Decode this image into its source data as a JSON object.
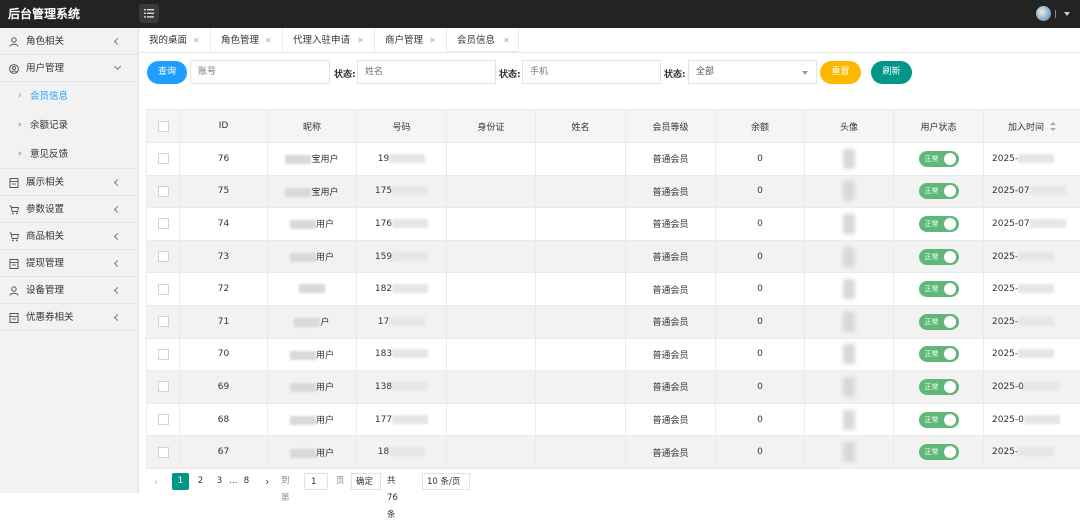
{
  "app": {
    "title": "后台管理系统"
  },
  "sidebar": {
    "items": [
      {
        "label": "角色相关",
        "icon": "user-icon"
      },
      {
        "label": "用户管理",
        "icon": "user-circle-icon",
        "expanded": true,
        "children": [
          {
            "label": "会员信息",
            "active": true
          },
          {
            "label": "余额记录"
          },
          {
            "label": "意见反馈"
          }
        ]
      },
      {
        "label": "展示相关",
        "icon": "document-icon"
      },
      {
        "label": "参数设置",
        "icon": "cart-icon"
      },
      {
        "label": "商品相关",
        "icon": "cart-icon"
      },
      {
        "label": "提现管理",
        "icon": "document-icon"
      },
      {
        "label": "设备管理",
        "icon": "user-icon"
      },
      {
        "label": "优惠券相关",
        "icon": "document-icon"
      }
    ]
  },
  "tabs": [
    {
      "label": "我的桌面"
    },
    {
      "label": "角色管理"
    },
    {
      "label": "代理入驻申请"
    },
    {
      "label": "商户管理"
    },
    {
      "label": "会员信息",
      "active": true
    }
  ],
  "search": {
    "query_label": "查询",
    "account_placeholder": "账号",
    "name_label": "状态:",
    "name_placeholder": "姓名",
    "phone_label": "状态:",
    "phone_placeholder": "手机",
    "status_label": "状态:",
    "status_value": "全部",
    "reset_label": "重置",
    "refresh_label": "刷新"
  },
  "table": {
    "columns": [
      "ID",
      "昵称",
      "号码",
      "身份证",
      "姓名",
      "会员等级",
      "余额",
      "头像",
      "用户状态",
      "加入时间"
    ],
    "rows": [
      {
        "id": "76",
        "nick": "宝用户",
        "phone": "19",
        "level": "普通会员",
        "balance": "0",
        "status": "正常",
        "date": "2025-"
      },
      {
        "id": "75",
        "nick": "宝用户",
        "phone": "175",
        "level": "普通会员",
        "balance": "0",
        "status": "正常",
        "date": "2025-07"
      },
      {
        "id": "74",
        "nick": "用户",
        "phone": "176",
        "level": "普通会员",
        "balance": "0",
        "status": "正常",
        "date": "2025-07"
      },
      {
        "id": "73",
        "nick": "用户",
        "phone": "159",
        "level": "普通会员",
        "balance": "0",
        "status": "正常",
        "date": "2025-"
      },
      {
        "id": "72",
        "nick": "",
        "phone": "182",
        "level": "普通会员",
        "balance": "0",
        "status": "正常",
        "date": "2025-"
      },
      {
        "id": "71",
        "nick": "户",
        "phone": "17",
        "level": "普通会员",
        "balance": "0",
        "status": "正常",
        "date": "2025-"
      },
      {
        "id": "70",
        "nick": "用户",
        "phone": "183",
        "level": "普通会员",
        "balance": "0",
        "status": "正常",
        "date": "2025-"
      },
      {
        "id": "69",
        "nick": "用户",
        "phone": "138",
        "level": "普通会员",
        "balance": "0",
        "status": "正常",
        "date": "2025-0"
      },
      {
        "id": "68",
        "nick": "用户",
        "phone": "177",
        "level": "普通会员",
        "balance": "0",
        "status": "正常",
        "date": "2025-0"
      },
      {
        "id": "67",
        "nick": "用户",
        "phone": "18",
        "level": "普通会员",
        "balance": "0",
        "status": "正常",
        "date": "2025-"
      }
    ]
  },
  "pager": {
    "pages": [
      "1",
      "2",
      "3",
      "…",
      "8"
    ],
    "goto_label": "到第",
    "goto_value": "1",
    "page_unit": "页",
    "confirm_label": "确定",
    "total_label": "共 76 条",
    "page_size": "10 条/页"
  },
  "colors": {
    "topbar": "#232323",
    "primary": "#1e9fff",
    "reset": "#ffb800",
    "refresh": "#009688",
    "status_on": "#5fb878"
  }
}
